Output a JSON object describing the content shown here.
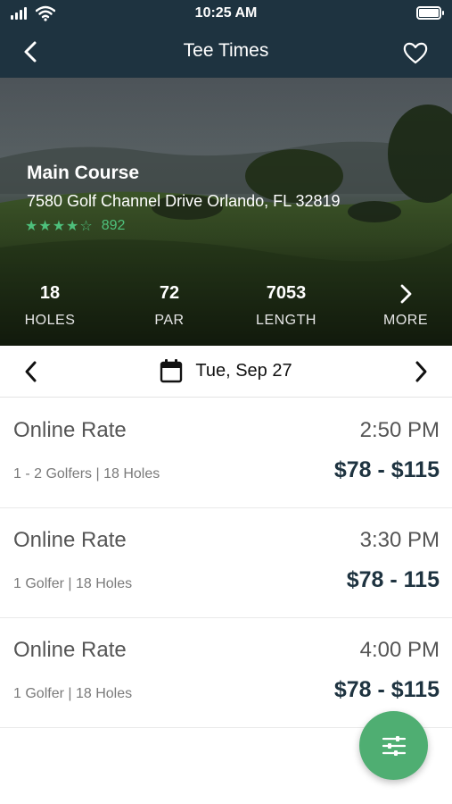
{
  "status_bar": {
    "time": "10:25 AM"
  },
  "nav": {
    "title": "Tee Times",
    "back_icon": "chevron-left-icon",
    "favorite_icon": "heart-outline-icon"
  },
  "course": {
    "name": "Main Course",
    "address": "7580 Golf Channel Drive Orlando, FL 32819",
    "rating_stars": 4,
    "stars_display": "★★★★☆",
    "review_count": "892"
  },
  "stats": [
    {
      "value": "18",
      "label": "HOLES"
    },
    {
      "value": "72",
      "label": "PAR"
    },
    {
      "value": "7053",
      "label": "LENGTH"
    },
    {
      "value": "",
      "label": "MORE"
    }
  ],
  "date_picker": {
    "date": "Tue, Sep 27",
    "calendar_icon": "calendar-icon"
  },
  "rates": [
    {
      "title": "Online Rate",
      "time": "2:50 PM",
      "details": "1 - 2 Golfers | 18 Holes",
      "price": "$78 - $115"
    },
    {
      "title": "Online Rate",
      "time": "3:30 PM",
      "details": "1 Golfer | 18 Holes",
      "price": "$78 - 115"
    },
    {
      "title": "Online Rate",
      "time": "4:00 PM",
      "details": "1 Golfer | 18 Holes",
      "price": "$78 - $115"
    }
  ],
  "colors": {
    "header": "#1e3340",
    "accent_green": "#4fae72",
    "star_green": "#4ec07c"
  }
}
